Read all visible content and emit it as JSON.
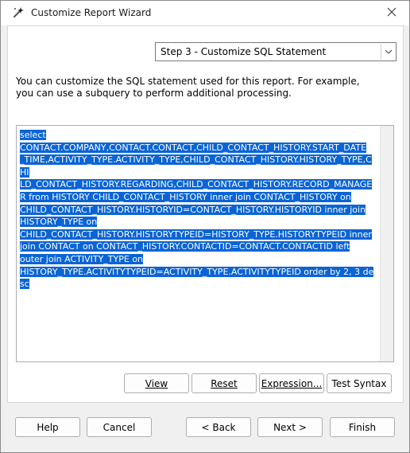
{
  "window": {
    "title": "Customize Report Wizard"
  },
  "step_selector": {
    "selected": "Step 3 - Customize SQL Statement"
  },
  "description": "You can customize the SQL statement used for this report. For example, you can use a subquery to perform additional processing.",
  "sql_statement": "select CONTACT.COMPANY,CONTACT.CONTACT,CHILD_CONTACT_HISTORY.START_DATE_TIME,ACTIVITY_TYPE.ACTIVITY_TYPE,CHILD_CONTACT_HISTORY.HISTORY_TYPE,CHILD_CONTACT_HISTORY.REGARDING,CHILD_CONTACT_HISTORY.RECORD_MANAGER from HISTORY CHILD_CONTACT_HISTORY inner join CONTACT_HISTORY on CHILD_CONTACT_HISTORY.HISTORYID=CONTACT_HISTORY.HISTORYID inner join HISTORY_TYPE on CHILD_CONTACT_HISTORY.HISTORYTYPEID=HISTORY_TYPE.HISTORYTYPEID inner join CONTACT on CONTACT_HISTORY.CONTACTID=CONTACT.CONTACTID left outer join ACTIVITY_TYPE on HISTORY_TYPE.ACTIVITYTYPEID=ACTIVITY_TYPE.ACTIVITYTYPEID order by 2, 3 desc",
  "sql_lines": [
    "select",
    "CONTACT.COMPANY,CONTACT.CONTACT,CHILD_CONTACT_HISTORY.START_DATE",
    "_TIME,ACTIVITY_TYPE.ACTIVITY_TYPE,CHILD_CONTACT_HISTORY.HISTORY_TYPE,CHI",
    "LD_CONTACT_HISTORY.REGARDING,CHILD_CONTACT_HISTORY.RECORD_MANAGE",
    "R from HISTORY CHILD_CONTACT_HISTORY inner join CONTACT_HISTORY on",
    "CHILD_CONTACT_HISTORY.HISTORYID=CONTACT_HISTORY.HISTORYID inner join",
    "HISTORY_TYPE on",
    "CHILD_CONTACT_HISTORY.HISTORYTYPEID=HISTORY_TYPE.HISTORYTYPEID inner",
    "join CONTACT on CONTACT_HISTORY.CONTACTID=CONTACT.CONTACTID left",
    "outer join ACTIVITY_TYPE on",
    "HISTORY_TYPE.ACTIVITYTYPEID=ACTIVITY_TYPE.ACTIVITYTYPEID order by 2, 3 desc"
  ],
  "sql_buttons": {
    "view": "View",
    "reset": "Reset",
    "expression": "Expression...",
    "test_syntax": "Test Syntax"
  },
  "nav_buttons": {
    "help": "Help",
    "cancel": "Cancel",
    "back": "< Back",
    "next": "Next >",
    "finish": "Finish"
  },
  "colors": {
    "selection": "#0a64d6",
    "window_bg": "#f0f0f0"
  },
  "icons": {
    "title": "wizard-wand-icon",
    "close": "close-icon",
    "dropdown": "chevron-down-icon"
  }
}
